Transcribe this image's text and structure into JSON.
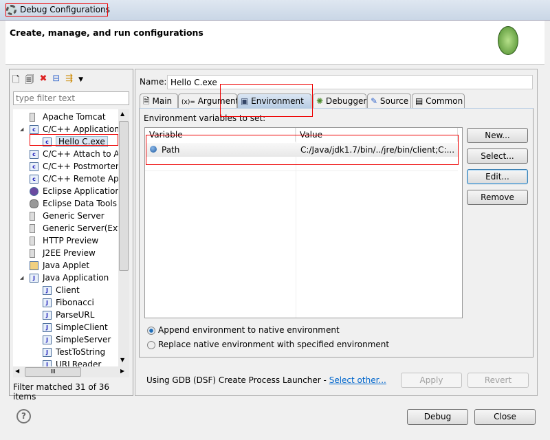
{
  "window": {
    "title": "Debug Configurations"
  },
  "header": {
    "title": "Create, manage, and run configurations"
  },
  "left": {
    "filter_placeholder": "type filter text",
    "tree": [
      {
        "label": "Apache Tomcat",
        "level": 1,
        "icon": "server-icon"
      },
      {
        "label": "C/C++ Application",
        "level": 1,
        "icon": "c-app-icon",
        "expanded": true
      },
      {
        "label": "Hello C.exe",
        "level": 2,
        "icon": "c-config-icon",
        "selected": true
      },
      {
        "label": "C/C++ Attach to App",
        "level": 1,
        "icon": "c-app-icon"
      },
      {
        "label": "C/C++ Postmortem",
        "level": 1,
        "icon": "c-app-icon"
      },
      {
        "label": "C/C++ Remote Appl",
        "level": 1,
        "icon": "c-app-icon"
      },
      {
        "label": "Eclipse Application",
        "level": 1,
        "icon": "eclipse-icon"
      },
      {
        "label": "Eclipse Data Tools",
        "level": 1,
        "icon": "database-icon"
      },
      {
        "label": "Generic Server",
        "level": 1,
        "icon": "server-icon"
      },
      {
        "label": "Generic Server(Extern",
        "level": 1,
        "icon": "server-icon"
      },
      {
        "label": "HTTP Preview",
        "level": 1,
        "icon": "server-icon"
      },
      {
        "label": "J2EE Preview",
        "level": 1,
        "icon": "server-icon"
      },
      {
        "label": "Java Applet",
        "level": 1,
        "icon": "applet-icon"
      },
      {
        "label": "Java Application",
        "level": 1,
        "icon": "java-app-icon",
        "expanded": true
      },
      {
        "label": "Client",
        "level": 2,
        "icon": "java-app-icon"
      },
      {
        "label": "Fibonacci",
        "level": 2,
        "icon": "java-app-icon"
      },
      {
        "label": "ParseURL",
        "level": 2,
        "icon": "java-app-icon"
      },
      {
        "label": "SimpleClient",
        "level": 2,
        "icon": "java-app-icon"
      },
      {
        "label": "SimpleServer",
        "level": 2,
        "icon": "java-app-icon"
      },
      {
        "label": "TestToString",
        "level": 2,
        "icon": "java-app-icon"
      },
      {
        "label": "URLReader",
        "level": 2,
        "icon": "java-app-icon"
      }
    ],
    "status": "Filter matched 31 of 36 items",
    "hscroll_thumb": "III"
  },
  "right": {
    "name_label": "Name:",
    "name_value": "Hello C.exe",
    "tabs": [
      "Main",
      "Arguments",
      "Environment",
      "Debugger",
      "Source",
      "Common"
    ],
    "active_tab": "Environment",
    "env_label": "Environment variables to set:",
    "columns": [
      "Variable",
      "Value"
    ],
    "rows": [
      {
        "variable": "Path",
        "value": "C:/Java/jdk1.7/bin/../jre/bin/client;C:..."
      }
    ],
    "buttons": {
      "new": "New...",
      "select": "Select...",
      "edit": "Edit...",
      "remove": "Remove"
    },
    "radio_append": "Append environment to native environment",
    "radio_replace": "Replace native environment with specified environment",
    "launcher_text": "Using GDB (DSF) Create Process Launcher -",
    "launcher_link": "Select other...",
    "apply": "Apply",
    "revert": "Revert"
  },
  "footer": {
    "help": "?",
    "debug": "Debug",
    "close": "Close"
  },
  "colors": {
    "annotation": "#e00000",
    "link": "#0066cc"
  }
}
